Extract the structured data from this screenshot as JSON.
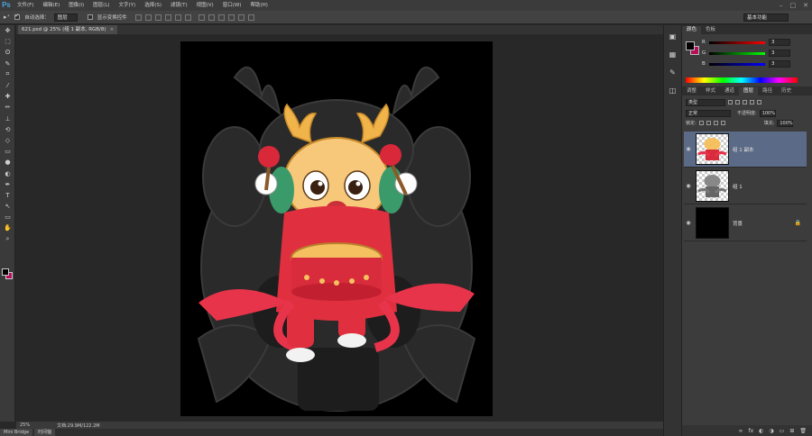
{
  "menubar": {
    "logo": "Ps",
    "items": [
      "文件(F)",
      "编辑(E)",
      "图像(I)",
      "图层(L)",
      "文字(Y)",
      "选择(S)",
      "滤镜(T)",
      "视图(V)",
      "窗口(W)",
      "帮助(H)"
    ],
    "window_controls": [
      "–",
      "□",
      "✕"
    ]
  },
  "options": {
    "tool_glyph": "▸⁺",
    "auto_select_label": "自动选择：",
    "auto_select_checked": true,
    "auto_select_target": "图层",
    "show_transform_label": "显示变换控件",
    "show_transform_checked": false,
    "workspace": "基本功能"
  },
  "toolbar": {
    "tools": [
      "move-tool",
      "marquee-tool",
      "lasso-tool",
      "quick-select-tool",
      "crop-tool",
      "eyedropper-tool",
      "healing-tool",
      "brush-tool",
      "clone-stamp-tool",
      "history-brush-tool",
      "eraser-tool",
      "gradient-tool",
      "blur-tool",
      "dodge-tool",
      "pen-tool",
      "type-tool",
      "path-select-tool",
      "shape-tool",
      "hand-tool",
      "zoom-tool"
    ],
    "glyphs": [
      "✥",
      "⬚",
      "ʘ",
      "✎",
      "⌗",
      "⁄",
      "✚",
      "✏",
      "⊥",
      "⟲",
      "◇",
      "▭",
      "●",
      "◐",
      "✒",
      "T",
      "↖",
      "▭",
      "✋",
      "⌕"
    ],
    "foreground_color": "#000000",
    "background_color": "#b4105a"
  },
  "document": {
    "tab_title": "621.psd @ 25% (组 1 副本, RGB/8)",
    "tab_close": "×",
    "zoom": "25%",
    "doc_info": "文档:29.9M/122.2M"
  },
  "bottom_tabs": [
    "Mini Bridge",
    "时间轴"
  ],
  "color_panel": {
    "tabs": [
      "颜色",
      "色板"
    ],
    "active_tab": "颜色",
    "sliders": [
      {
        "label": "R",
        "value": "3",
        "gradient": "linear-gradient(to right,#000,#ff0000)"
      },
      {
        "label": "G",
        "value": "3",
        "gradient": "linear-gradient(to right,#000,#00ff00)"
      },
      {
        "label": "B",
        "value": "3",
        "gradient": "linear-gradient(to right,#000,#0000ff)"
      }
    ]
  },
  "layers_panel": {
    "tabs": [
      "调整",
      "样式",
      "通道",
      "图层",
      "路径",
      "历史"
    ],
    "active_tab": "图层",
    "filter_kind": "类型",
    "blend_mode": "正常",
    "opacity_label": "不透明度:",
    "opacity": "100%",
    "lock_label": "锁定:",
    "fill_label": "填充:",
    "fill": "100%",
    "layers": [
      {
        "name": "组 1 副本",
        "selected": true,
        "thumb": "checker",
        "locked": false
      },
      {
        "name": "组 1",
        "selected": false,
        "thumb": "checker",
        "locked": false
      },
      {
        "name": "背景",
        "selected": false,
        "thumb": "black",
        "locked": true
      }
    ],
    "bottom_icons": [
      "∞",
      "fx",
      "◐",
      "◑",
      "▭",
      "⊞",
      "🗑"
    ]
  },
  "side_strip": {
    "icons": [
      "color-panel-icon",
      "swatches-icon",
      "adjustments-icon",
      "layers-icon"
    ],
    "glyphs": [
      "▣",
      "▦",
      "✎",
      "◫"
    ]
  }
}
